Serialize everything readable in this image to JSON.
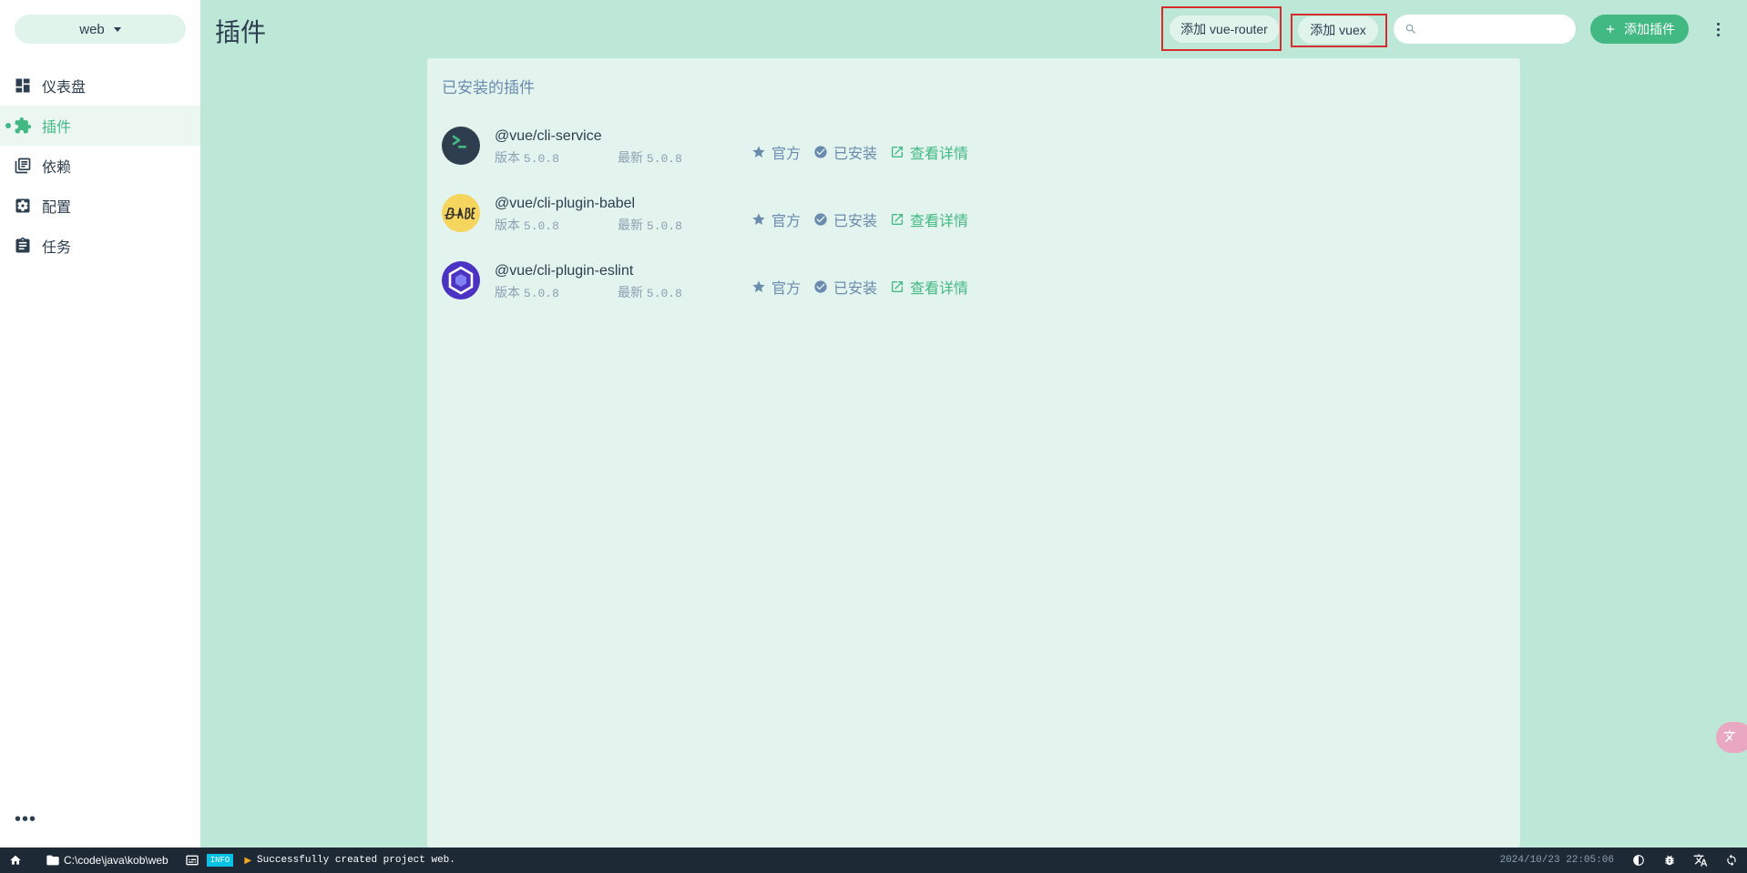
{
  "sidebar": {
    "project": "web",
    "nav": [
      {
        "label": "仪表盘",
        "icon": "dashboard-icon",
        "active": false
      },
      {
        "label": "插件",
        "icon": "puzzle-icon",
        "active": true
      },
      {
        "label": "依赖",
        "icon": "library-books-icon",
        "active": false
      },
      {
        "label": "配置",
        "icon": "settings-applications-icon",
        "active": false
      },
      {
        "label": "任务",
        "icon": "clipboard-icon",
        "active": false
      }
    ],
    "more": "•••"
  },
  "header": {
    "title": "插件",
    "add_router_label": "添加 vue-router",
    "add_vuex_label": "添加 vuex",
    "search_placeholder": "",
    "add_plugin_label": "添加插件"
  },
  "panel": {
    "title": "已安装的插件",
    "version_label": "版本",
    "latest_label": "最新",
    "official_label": "官方",
    "installed_label": "已安装",
    "details_label": "查看详情",
    "plugins": [
      {
        "name": "@vue/cli-service",
        "version": "5.0.8",
        "latest": "5.0.8",
        "logo": "vue-cli-logo"
      },
      {
        "name": "@vue/cli-plugin-babel",
        "version": "5.0.8",
        "latest": "5.0.8",
        "logo": "babel-logo"
      },
      {
        "name": "@vue/cli-plugin-eslint",
        "version": "5.0.8",
        "latest": "5.0.8",
        "logo": "eslint-logo"
      }
    ]
  },
  "statusbar": {
    "path": "C:\\code\\java\\kob\\web",
    "log_level": "INFO",
    "log_message": "Successfully created project web.",
    "timestamp": "2024/10/23 22:05:06"
  },
  "colors": {
    "accent": "#42b983",
    "background": "#bde7d6",
    "panel": "#e3f4ee",
    "text": "#2c3e50",
    "muted": "#6a8bad",
    "statusbar": "#1d2935",
    "highlight": "#d62c2c"
  }
}
